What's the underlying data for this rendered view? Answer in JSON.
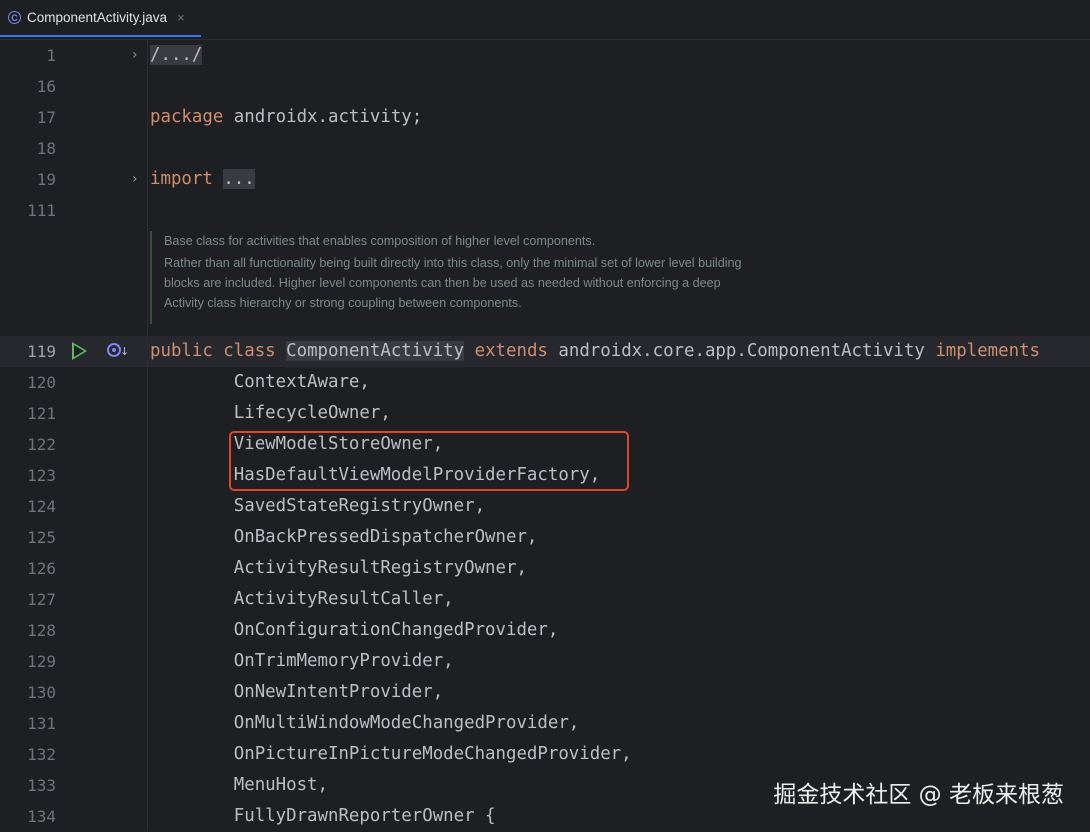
{
  "tab": {
    "icon": "class-icon",
    "title": "ComponentActivity.java",
    "close": "×"
  },
  "lines": [
    {
      "no": "1",
      "fold": "›",
      "segments": [
        {
          "t": "/.../",
          "c": "fold-box"
        }
      ]
    },
    {
      "no": "16",
      "fold": "",
      "segments": []
    },
    {
      "no": "17",
      "fold": "",
      "segments": [
        {
          "t": "package",
          "c": "kw"
        },
        {
          "t": " androidx.activity;",
          "c": ""
        }
      ]
    },
    {
      "no": "18",
      "fold": "",
      "segments": []
    },
    {
      "no": "19",
      "fold": "›",
      "segments": [
        {
          "t": "import",
          "c": "kw"
        },
        {
          "t": " ",
          "c": ""
        },
        {
          "t": "...",
          "c": "fold-box"
        }
      ]
    },
    {
      "no": "111",
      "fold": "",
      "segments": []
    },
    {
      "no": "119",
      "fold": "",
      "current": true,
      "segments": [
        {
          "t": "public class",
          "c": "kw"
        },
        {
          "t": " ",
          "c": ""
        },
        {
          "t": "ComponentActivity",
          "c": "cls-hl"
        },
        {
          "t": " ",
          "c": ""
        },
        {
          "t": "extends",
          "c": "kw"
        },
        {
          "t": " androidx.core.app.ComponentActivity ",
          "c": ""
        },
        {
          "t": "implements",
          "c": "kw"
        }
      ]
    },
    {
      "no": "120",
      "fold": "",
      "segments": [
        {
          "t": "        ContextAware,",
          "c": ""
        }
      ]
    },
    {
      "no": "121",
      "fold": "",
      "segments": [
        {
          "t": "        LifecycleOwner,",
          "c": ""
        }
      ]
    },
    {
      "no": "122",
      "fold": "",
      "segments": [
        {
          "t": "        ViewModelStoreOwner,",
          "c": ""
        }
      ]
    },
    {
      "no": "123",
      "fold": "",
      "segments": [
        {
          "t": "        HasDefaultViewModelProviderFactory,",
          "c": ""
        }
      ]
    },
    {
      "no": "124",
      "fold": "",
      "segments": [
        {
          "t": "        SavedStateRegistryOwner,",
          "c": ""
        }
      ]
    },
    {
      "no": "125",
      "fold": "",
      "segments": [
        {
          "t": "        OnBackPressedDispatcherOwner,",
          "c": ""
        }
      ]
    },
    {
      "no": "126",
      "fold": "",
      "segments": [
        {
          "t": "        ActivityResultRegistryOwner,",
          "c": ""
        }
      ]
    },
    {
      "no": "127",
      "fold": "",
      "segments": [
        {
          "t": "        ActivityResultCaller,",
          "c": ""
        }
      ]
    },
    {
      "no": "128",
      "fold": "",
      "segments": [
        {
          "t": "        OnConfigurationChangedProvider,",
          "c": ""
        }
      ]
    },
    {
      "no": "129",
      "fold": "",
      "segments": [
        {
          "t": "        OnTrimMemoryProvider,",
          "c": ""
        }
      ]
    },
    {
      "no": "130",
      "fold": "",
      "segments": [
        {
          "t": "        OnNewIntentProvider,",
          "c": ""
        }
      ]
    },
    {
      "no": "131",
      "fold": "",
      "segments": [
        {
          "t": "        OnMultiWindowModeChangedProvider,",
          "c": ""
        }
      ]
    },
    {
      "no": "132",
      "fold": "",
      "segments": [
        {
          "t": "        OnPictureInPictureModeChangedProvider,",
          "c": ""
        }
      ]
    },
    {
      "no": "133",
      "fold": "",
      "segments": [
        {
          "t": "        MenuHost,",
          "c": ""
        }
      ]
    },
    {
      "no": "134",
      "fold": "",
      "segments": [
        {
          "t": "        FullyDrawnReporterOwner {",
          "c": ""
        }
      ]
    }
  ],
  "javadoc": {
    "first": "Base class for activities that enables composition of higher level components.",
    "rest": [
      "Rather than all functionality being built directly into this class, only the minimal set of lower level building",
      "blocks are included. Higher level components can then be used as needed without enforcing a deep",
      "Activity class hierarchy or strong coupling between components."
    ]
  },
  "gutter_icons": {
    "run": "run-icon",
    "implementations": "implemented-by-icon"
  },
  "colors": {
    "keyword": "#cf8e6d",
    "highlight_box": "#e0442e",
    "doc": "#7e8a84"
  },
  "watermark": "掘金技术社区 @ 老板来根葱"
}
